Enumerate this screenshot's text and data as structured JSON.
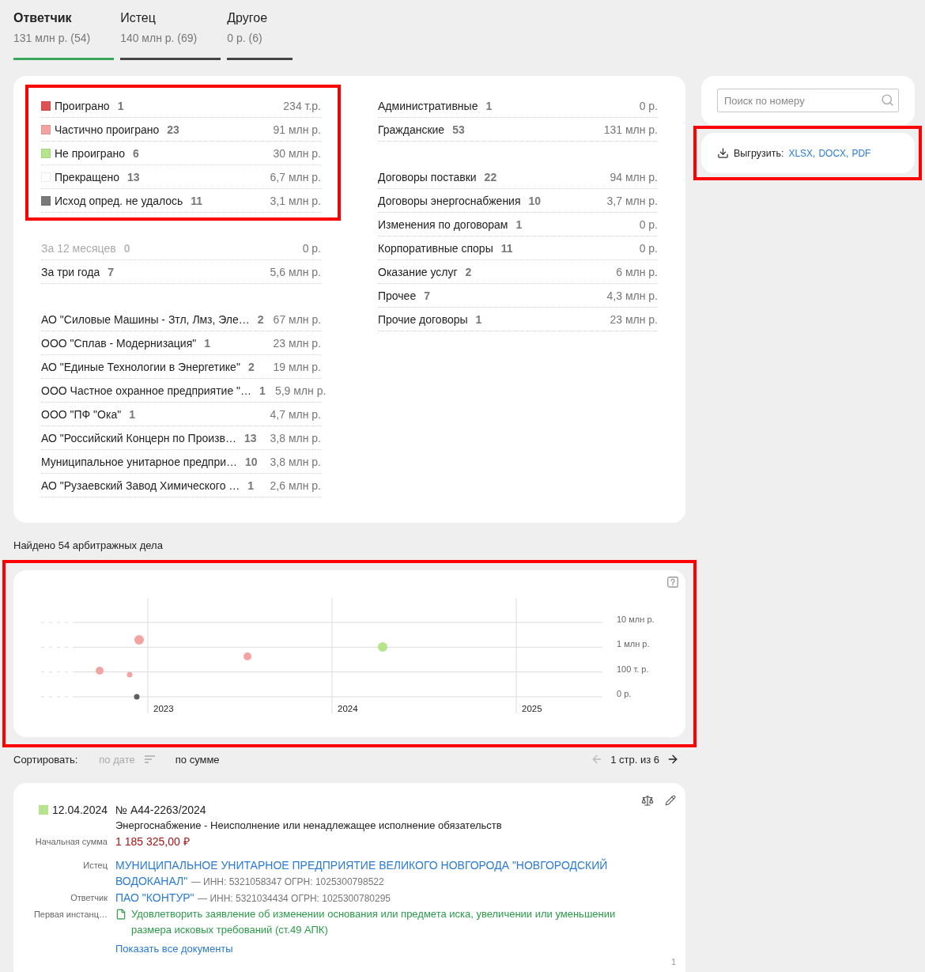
{
  "tabs": [
    {
      "title": "Ответчик",
      "subtitle": "131 млн р. (54)",
      "selected": true
    },
    {
      "title": "Истец",
      "subtitle": "140 млн р. (69)",
      "selected": false
    },
    {
      "title": "Другое",
      "subtitle": "0 р. (6)",
      "selected": false
    }
  ],
  "summary": {
    "left_groups": [
      {
        "kind": "legend",
        "highlighted": true,
        "rows": [
          {
            "label": "Проиграно",
            "count": "1",
            "amount": "234 т.р.",
            "color": "#e05252"
          },
          {
            "label": "Частично проиграно",
            "count": "23",
            "amount": "91 млн р.",
            "color": "#f4a3a3"
          },
          {
            "label": "Не проиграно",
            "count": "6",
            "amount": "30 млн р.",
            "color": "#b5e48c"
          },
          {
            "label": "Прекращено",
            "count": "13",
            "amount": "6,7 млн р.",
            "color": "#ffffff"
          },
          {
            "label": "Исход опред. не удалось",
            "count": "11",
            "amount": "3,1 млн р.",
            "color": "#7a7a7a"
          }
        ]
      },
      {
        "kind": "list",
        "highlighted": false,
        "rows": [
          {
            "label": "За 12 месяцев",
            "count": "0",
            "amount": "0 р.",
            "disabled": true
          },
          {
            "label": "За три года",
            "count": "7",
            "amount": "5,6 млн р.",
            "disabled": false
          }
        ]
      },
      {
        "kind": "list",
        "highlighted": false,
        "rows": [
          {
            "label": "АО \"Силовые Машины - Зтл, Лмз, Эле…",
            "count": "2",
            "amount": "67 млн р."
          },
          {
            "label": "ООО \"Сплав - Модернизация\"",
            "count": "1",
            "amount": "23 млн р."
          },
          {
            "label": "АО \"Единые Технологии в Энергетике\"",
            "count": "2",
            "amount": "19 млн р."
          },
          {
            "label": "ООО Частное охранное предприятие \"…",
            "count": "1",
            "amount": "5,9 млн р."
          },
          {
            "label": "ООО \"ПФ \"Ока\"",
            "count": "1",
            "amount": "4,7 млн р."
          },
          {
            "label": "АО \"Российский Концерн по Произв…",
            "count": "13",
            "amount": "3,8 млн р."
          },
          {
            "label": "Муниципальное унитарное предпри…",
            "count": "10",
            "amount": "3,8 млн р."
          },
          {
            "label": "АО \"Рузаевский Завод Химического …",
            "count": "1",
            "amount": "2,6 млн р."
          }
        ]
      }
    ],
    "right_groups": [
      {
        "kind": "list",
        "highlighted": false,
        "rows": [
          {
            "label": "Административные",
            "count": "1",
            "amount": "0 р."
          },
          {
            "label": "Гражданские",
            "count": "53",
            "amount": "131 млн р."
          }
        ]
      },
      {
        "kind": "list",
        "highlighted": false,
        "rows": [
          {
            "label": "Договоры поставки",
            "count": "22",
            "amount": "94 млн р."
          },
          {
            "label": "Договоры энергоснабжения",
            "count": "10",
            "amount": "3,7 млн р."
          },
          {
            "label": "Изменения по договорам",
            "count": "1",
            "amount": "0 р."
          },
          {
            "label": "Корпоративные споры",
            "count": "11",
            "amount": "0 р."
          },
          {
            "label": "Оказание услуг",
            "count": "2",
            "amount": "6 млн р."
          },
          {
            "label": "Прочее",
            "count": "7",
            "amount": "4,3 млн р."
          },
          {
            "label": "Прочие договоры",
            "count": "1",
            "amount": "23 млн р."
          }
        ]
      }
    ]
  },
  "sidebar": {
    "search": {
      "placeholder": "Поиск по номеру"
    },
    "export": {
      "label": "Выгрузить:",
      "formats": [
        "XLSX",
        "DOCX",
        "PDF"
      ],
      "separator": ",",
      "highlighted": true
    }
  },
  "results_title": "Найдено 54 арбитражных дела",
  "chart": {
    "highlighted": true,
    "y_labels": [
      "10 млн р.",
      "1 млн р.",
      "100 т. р.",
      "0 р."
    ],
    "x_labels": [
      "2023",
      "2024",
      "2025"
    ],
    "points": [
      {
        "color": "#f4a3a3"
      },
      {
        "color": "#f4a3a3"
      },
      {
        "color": "#5f5f5f"
      },
      {
        "color": "#f4a3a3"
      },
      {
        "color": "#f4a3a3"
      },
      {
        "color": "#b5e48c"
      }
    ]
  },
  "sorting": {
    "label": "Сортировать:",
    "options": [
      {
        "label": "по дате",
        "selected": true
      },
      {
        "label": "по сумме",
        "selected": false
      }
    ]
  },
  "pagination": {
    "label": "1 стр. из 6",
    "prev_disabled": true,
    "next_disabled": false
  },
  "cases": [
    {
      "color": "#b5e48c",
      "date": "12.04.2024",
      "number": "№ А44-2263/2024",
      "subject": "Энергоснабжение - Неисполнение или ненадлежащее исполнение обязательств",
      "fields": [
        {
          "kind": "amount",
          "label": "Начальная сумма",
          "value": "1 185 325,00 ₽"
        },
        {
          "kind": "party",
          "label": "Истец",
          "name": "МУНИЦИПАЛЬНОЕ УНИТАРНОЕ ПРЕДПРИЯТИЕ ВЕЛИКОГО НОВГОРОДА \"НОВГОРОДСКИЙ ВОДОКАНАЛ\"",
          "details": "— ИНН: 5321058347 ОГРН: 1025300798522"
        },
        {
          "kind": "party",
          "label": "Ответчик",
          "name": "ПАО \"КОНТУР\"",
          "details": "— ИНН: 5321034434 ОГРН: 1025300780295"
        },
        {
          "kind": "document",
          "label": "Первая инстанц…",
          "text": "Удовлетворить заявление об изменении основания или предмета иска, увеличении или уменьшении размера исковых требований (ст.49 АПК)"
        }
      ],
      "documents_link": "Показать все документы",
      "index": "1"
    }
  ]
}
